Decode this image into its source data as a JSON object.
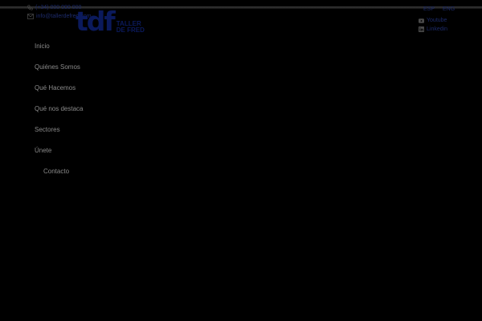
{
  "header": {
    "contact": {
      "phone": "(+34) 000 000 000",
      "email": "info@tallerdefred.com"
    },
    "logo": {
      "mark": "tdf",
      "tagline": "TALLER\nDE FRED"
    },
    "languages": [
      "ESP",
      "ENG"
    ],
    "social": [
      {
        "icon": "youtube-icon",
        "label": "Youtube"
      },
      {
        "icon": "linkedin-icon",
        "label": "Linkedin"
      }
    ]
  },
  "nav": {
    "items": [
      {
        "label": "Inicio"
      },
      {
        "label": "Quiénes Somos"
      },
      {
        "label": "Qué Hacemos"
      },
      {
        "label": "Qué nos destaca"
      },
      {
        "label": "Sectores"
      },
      {
        "label": "Únete"
      },
      {
        "label": "Contacto"
      }
    ]
  },
  "colors": {
    "background": "#000000",
    "brand": "#0b1a5c",
    "nav_text": "#8a8a8a"
  }
}
